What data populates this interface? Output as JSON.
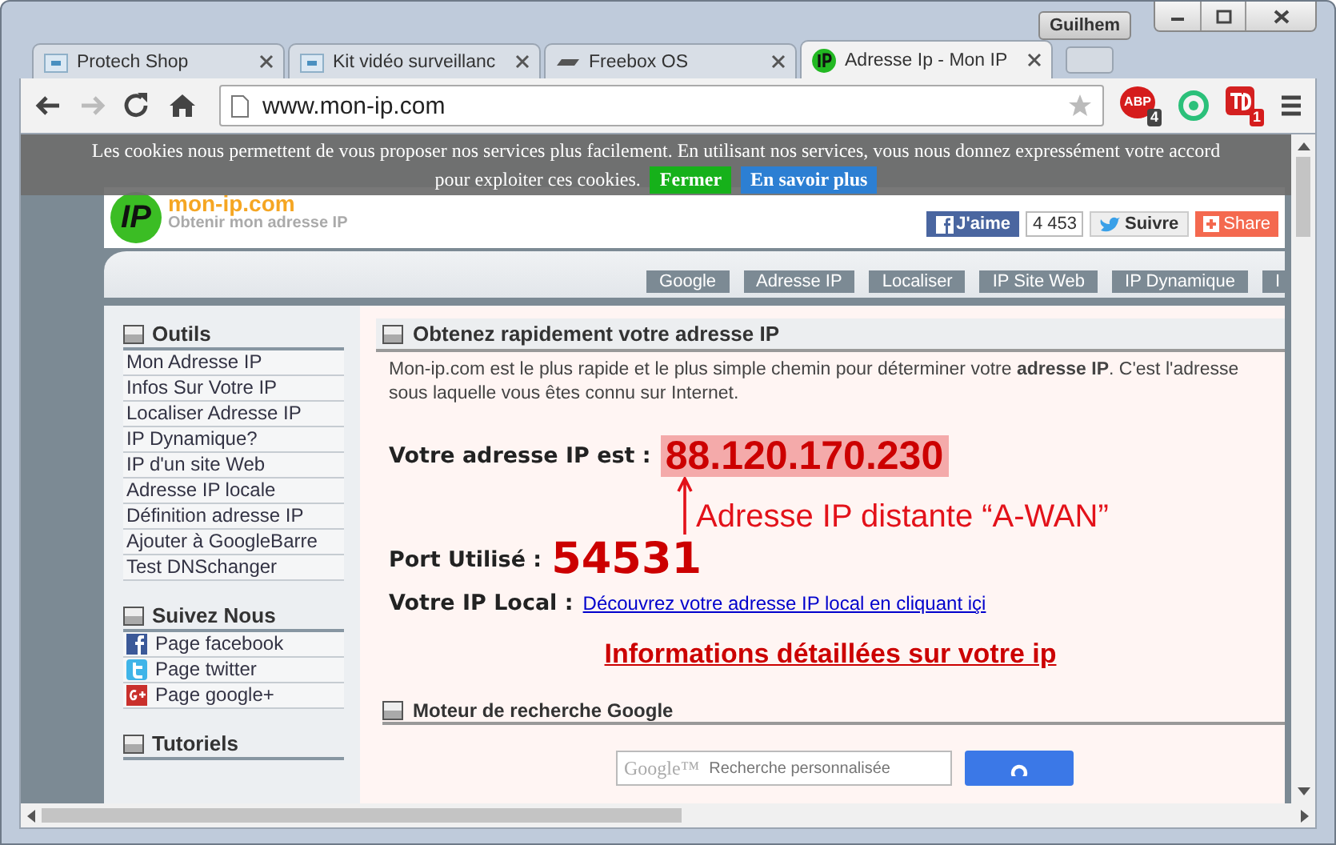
{
  "window": {
    "user": "Guilhem"
  },
  "tabs": [
    {
      "label": "Protech Shop",
      "kind": "box",
      "selected": false
    },
    {
      "label": "Kit vidéo surveillanc",
      "kind": "box",
      "selected": false
    },
    {
      "label": "Freebox OS",
      "kind": "device",
      "selected": false
    },
    {
      "label": "Adresse Ip - Mon IP",
      "kind": "ip",
      "selected": true
    }
  ],
  "toolbar": {
    "url": "www.mon-ip.com",
    "abp_label": "ABP",
    "abp_badge": "4",
    "td_badge": "1"
  },
  "cookie_banner": {
    "text": "Les cookies nous permettent de vous proposer nos services plus facilement. En utilisant nos services, vous nous donnez expressément votre accord",
    "text_2": "pour exploiter ces cookies.",
    "buttons": [
      {
        "label": "Fermer",
        "kind": "close"
      },
      {
        "label": "En savoir plus",
        "kind": "info"
      }
    ]
  },
  "header": {
    "logo": "IP",
    "site_name": "mon-ip.com",
    "tagline": "Obtenir mon adresse IP",
    "like": "J'aime",
    "like_count": "4 453",
    "follow": "Suivre",
    "share": "Share"
  },
  "nav": [
    "Google",
    "Adresse IP",
    "Localiser",
    "IP Site Web",
    "IP Dynamique",
    "I"
  ],
  "sidebar": [
    {
      "title": "Outils",
      "items": [
        {
          "label": "Mon Adresse IP"
        },
        {
          "label": "Infos Sur Votre IP"
        },
        {
          "label": "Localiser Adresse IP"
        },
        {
          "label": "IP Dynamique?"
        },
        {
          "label": "IP d'un site Web"
        },
        {
          "label": "Adresse IP locale"
        },
        {
          "label": "Définition adresse IP"
        },
        {
          "label": "Ajouter à GoogleBarre"
        },
        {
          "label": "Test DNSchanger"
        }
      ]
    },
    {
      "title": "Suivez Nous",
      "items": [
        {
          "label": "Page facebook",
          "kind": "facebook"
        },
        {
          "label": "Page twitter",
          "kind": "twitter"
        },
        {
          "label": "Page google+",
          "kind": "google"
        }
      ]
    },
    {
      "title": "Tutoriels"
    }
  ],
  "content": {
    "section_title": "Obtenez rapidement votre adresse IP",
    "intro": "Mon-ip.com est le plus rapide et le plus simple chemin pour déterminer votre **adresse IP**. C'est l'adresse",
    "intro_2": "sous laquelle vous êtes connu sur Internet.",
    "ip_label": "Votre adresse IP est :",
    "ip_value": "88.120.170.230",
    "annotation": "Adresse IP distante “A-WAN”",
    "port_label": "Port Utilisé :",
    "port_value": "54531",
    "local_label": "Votre IP Local :",
    "local_link": "Découvrez votre adresse IP local en cliquant içi",
    "details_link": "Informations détaillées sur votre ip",
    "search_title": "Moteur de recherche Google",
    "search_brand": "Google™",
    "search_placeholder": "Recherche personnalisée"
  }
}
